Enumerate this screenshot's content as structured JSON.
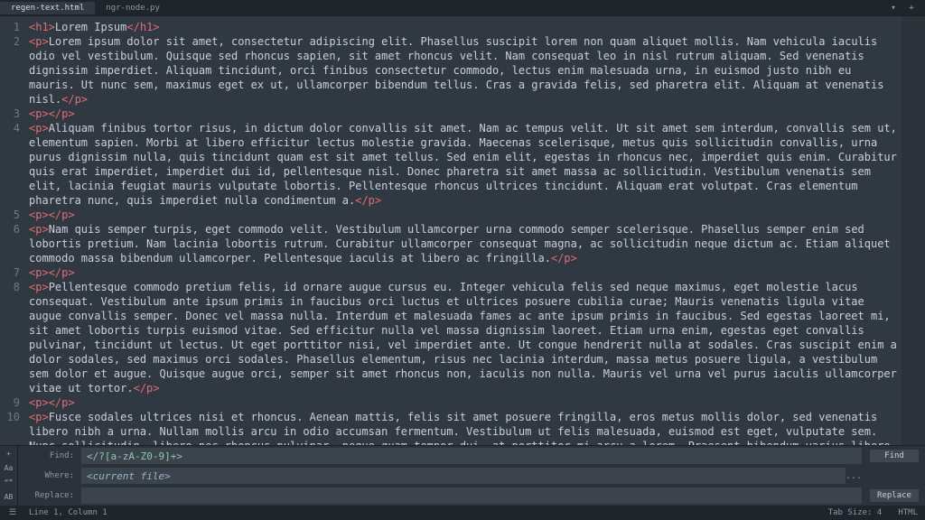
{
  "tabs": {
    "active": "regen-text.html",
    "other": "ngr-node.py"
  },
  "lines": [
    {
      "n": "1",
      "open": "h1",
      "text": "Lorem Ipsum",
      "close": "h1"
    },
    {
      "n": "2",
      "open": "p",
      "text": "Lorem ipsum dolor sit amet, consectetur adipiscing elit. Phasellus suscipit lorem non quam aliquet mollis. Nam vehicula iaculis odio vel vestibulum. Quisque sed rhoncus sapien, sit amet rhoncus velit. Nam consequat leo in nisl rutrum aliquam. Sed venenatis dignissim imperdiet. Aliquam tincidunt, orci finibus consectetur commodo, lectus enim malesuada urna, in euismod justo nibh eu mauris. Ut nunc sem, maximus eget ex ut, ullamcorper bibendum tellus. Cras a gravida felis, sed pharetra elit. Aliquam at venenatis nisl.",
      "close": "p"
    },
    {
      "n": "3",
      "open": "p",
      "text": "",
      "close": "p"
    },
    {
      "n": "4",
      "open": "p",
      "text": "Aliquam finibus tortor risus, in dictum dolor convallis sit amet. Nam ac tempus velit. Ut sit amet sem interdum, convallis sem ut, elementum sapien. Morbi at libero efficitur lectus molestie gravida. Maecenas scelerisque, metus quis sollicitudin convallis, urna purus dignissim nulla, quis tincidunt quam est sit amet tellus. Sed enim elit, egestas in rhoncus nec, imperdiet quis enim. Curabitur quis erat imperdiet, imperdiet dui id, pellentesque nisl. Donec pharetra sit amet massa ac sollicitudin. Vestibulum venenatis sem elit, lacinia feugiat mauris vulputate lobortis. Pellentesque rhoncus ultrices tincidunt. Aliquam erat volutpat. Cras elementum pharetra nunc, quis imperdiet nulla condimentum a.",
      "close": "p"
    },
    {
      "n": "5",
      "open": "p",
      "text": "",
      "close": "p"
    },
    {
      "n": "6",
      "open": "p",
      "text": "Nam quis semper turpis, eget commodo velit. Vestibulum ullamcorper urna commodo semper scelerisque. Phasellus semper enim sed lobortis pretium. Nam lacinia lobortis rutrum. Curabitur ullamcorper consequat magna, ac sollicitudin neque dictum ac. Etiam aliquet commodo massa bibendum ullamcorper. Pellentesque iaculis at libero ac fringilla.",
      "close": "p"
    },
    {
      "n": "7",
      "open": "p",
      "text": "",
      "close": "p"
    },
    {
      "n": "8",
      "open": "p",
      "text": "Pellentesque commodo pretium felis, id ornare augue cursus eu. Integer vehicula felis sed neque maximus, eget molestie lacus consequat. Vestibulum ante ipsum primis in faucibus orci luctus et ultrices posuere cubilia curae; Mauris venenatis ligula vitae augue convallis semper. Donec vel massa nulla. Interdum et malesuada fames ac ante ipsum primis in faucibus. Sed egestas laoreet mi, sit amet lobortis turpis euismod vitae. Sed efficitur nulla vel massa dignissim laoreet. Etiam urna enim, egestas eget convallis pulvinar, tincidunt ut lectus. Ut eget porttitor nisi, vel imperdiet ante. Ut congue hendrerit nulla at sodales. Cras suscipit enim a dolor sodales, sed maximus orci sodales. Phasellus elementum, risus nec lacinia interdum, massa metus posuere ligula, a vestibulum sem dolor et augue. Quisque augue orci, semper sit amet rhoncus non, iaculis non nulla. Mauris vel urna vel purus iaculis ullamcorper vitae ut tortor.",
      "close": "p"
    },
    {
      "n": "9",
      "open": "p",
      "text": "",
      "close": "p"
    },
    {
      "n": "10",
      "open": "p",
      "text": "Fusce sodales ultrices nisi et rhoncus. Aenean mattis, felis sit amet posuere fringilla, eros metus mollis dolor, sed venenatis libero nibh a urna. Nullam mollis arcu in odio accumsan fermentum. Vestibulum ut felis malesuada, euismod est eget, vulputate sem. Nunc sollicitudin, libero nec rhoncus pulvinar, neque quam tempor dui, at porttitor mi arcu a lorem. Praesent bibendum varius libero. Maecenas volutpat vitae est ac vulputate. Curabitur fermentum justo maximus dictum",
      "close": null
    }
  ],
  "find": {
    "label_find": "Find:",
    "label_where": "Where:",
    "label_replace": "Replace:",
    "value_find": "</?[a-zA-Z0-9]+>",
    "value_where": "<current file>",
    "value_replace": "",
    "btn_find": "Find",
    "btn_replace": "Replace",
    "btn_more": "...",
    "icon_plus": "+",
    "icon_case": "Aa",
    "icon_word": "“”",
    "icon_all": "AB",
    "icon_regex": ".*"
  },
  "status": {
    "menu": "☰",
    "pos": "Line 1, Column 1",
    "tabsize": "Tab Size: 4",
    "syntax": "HTML"
  }
}
